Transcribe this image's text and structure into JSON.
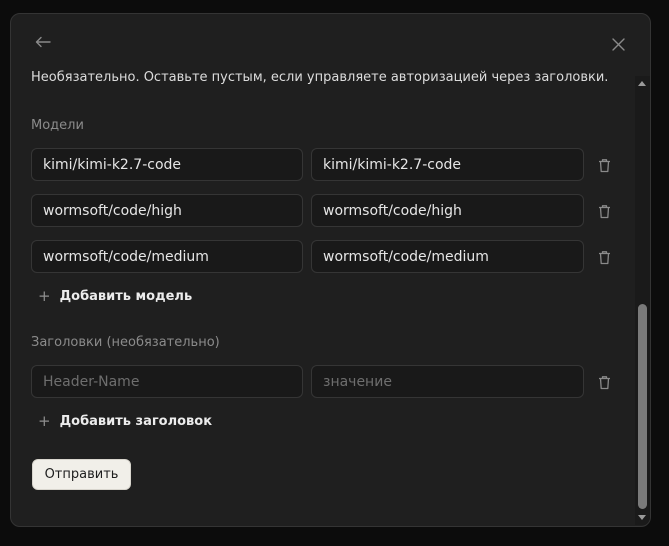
{
  "hint": "Необязательно. Оставьте пустым, если управляете авторизацией через заголовки.",
  "models": {
    "label": "Модели",
    "rows": [
      {
        "model": "kimi/kimi-k2.7-code",
        "alias": "kimi/kimi-k2.7-code"
      },
      {
        "model": "wormsoft/code/high",
        "alias": "wormsoft/code/high"
      },
      {
        "model": "wormsoft/code/medium",
        "alias": "wormsoft/code/medium"
      }
    ],
    "add_label": "Добавить модель"
  },
  "headers": {
    "label": "Заголовки (необязательно)",
    "name_placeholder": "Header-Name",
    "value_placeholder": "значение",
    "add_label": "Добавить заголовок"
  },
  "submit_label": "Отправить",
  "icons": {
    "back": "arrow-left-icon",
    "close": "close-icon",
    "trash": "trash-icon",
    "plus": "plus-icon"
  }
}
